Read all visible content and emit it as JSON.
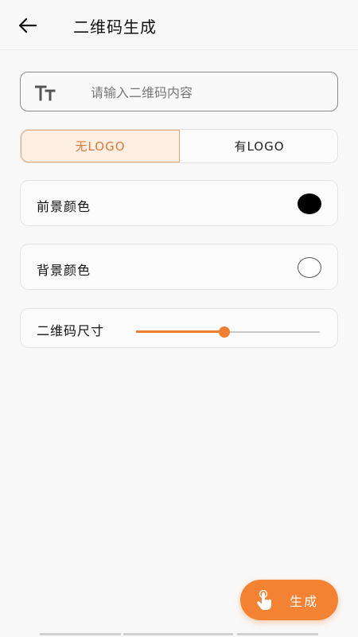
{
  "header": {
    "title": "二维码生成"
  },
  "input": {
    "placeholder": "请输入二维码内容",
    "value": ""
  },
  "logo_toggle": {
    "options": [
      "无LOGO",
      "有LOGO"
    ],
    "selected": "无LOGO",
    "accent": "#e07a36"
  },
  "foreground": {
    "label": "前景颜色",
    "color": "#000000"
  },
  "background": {
    "label": "背景颜色",
    "color": "#ffffff"
  },
  "size": {
    "label": "二维码尺寸",
    "value_fraction": 0.48
  },
  "generate": {
    "label": "生成"
  },
  "colors": {
    "accent": "#f38233"
  }
}
